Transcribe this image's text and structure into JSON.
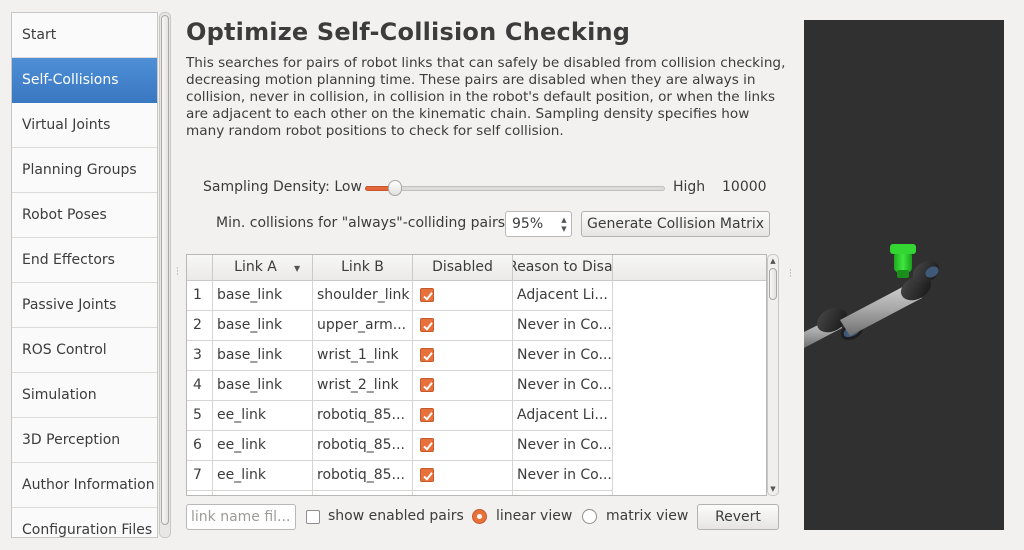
{
  "nav": {
    "items": [
      {
        "label": "Start",
        "active": false
      },
      {
        "label": "Self-Collisions",
        "active": true
      },
      {
        "label": "Virtual Joints",
        "active": false
      },
      {
        "label": "Planning Groups",
        "active": false
      },
      {
        "label": "Robot Poses",
        "active": false
      },
      {
        "label": "End Effectors",
        "active": false
      },
      {
        "label": "Passive Joints",
        "active": false
      },
      {
        "label": "ROS Control",
        "active": false
      },
      {
        "label": "Simulation",
        "active": false
      },
      {
        "label": "3D Perception",
        "active": false
      },
      {
        "label": "Author Information",
        "active": false
      },
      {
        "label": "Configuration Files",
        "active": false
      }
    ]
  },
  "page": {
    "title": "Optimize Self-Collision Checking",
    "description": "This searches for pairs of robot links that can safely be disabled from collision checking, decreasing motion planning time. These pairs are disabled when they are always in collision, never in collision, in collision in the robot's default position, or when the links are adjacent to each other on the kinematic chain. Sampling density specifies how many random robot positions to check for self collision."
  },
  "density": {
    "label": "Sampling Density: Low",
    "high_label": "High",
    "value": "10000",
    "slider_fraction": 0.1
  },
  "min_collisions": {
    "label": "Min. collisions for \"always\"-colliding pairs:",
    "value": "95%"
  },
  "generate_button": "Generate Collision Matrix",
  "table": {
    "headers": {
      "link_a": "Link A",
      "link_b": "Link B",
      "disabled": "Disabled",
      "reason": "Reason to Disable"
    },
    "rows": [
      {
        "index": "1",
        "link_a": "base_link",
        "link_b": "shoulder_link",
        "disabled": true,
        "reason": "Adjacent Li..."
      },
      {
        "index": "2",
        "link_a": "base_link",
        "link_b": "upper_arm...",
        "disabled": true,
        "reason": "Never in Co..."
      },
      {
        "index": "3",
        "link_a": "base_link",
        "link_b": "wrist_1_link",
        "disabled": true,
        "reason": "Never in Co..."
      },
      {
        "index": "4",
        "link_a": "base_link",
        "link_b": "wrist_2_link",
        "disabled": true,
        "reason": "Never in Co..."
      },
      {
        "index": "5",
        "link_a": "ee_link",
        "link_b": "robotiq_85...",
        "disabled": true,
        "reason": "Adjacent Li..."
      },
      {
        "index": "6",
        "link_a": "ee_link",
        "link_b": "robotiq_85...",
        "disabled": true,
        "reason": "Never in Co..."
      },
      {
        "index": "7",
        "link_a": "ee_link",
        "link_b": "robotiq_85...",
        "disabled": true,
        "reason": "Never in Co..."
      }
    ]
  },
  "bottom": {
    "filter_placeholder": "link name fil...",
    "show_enabled_label": "show enabled pairs",
    "show_enabled_checked": false,
    "linear_view_label": "linear view",
    "linear_view_selected": true,
    "matrix_view_label": "matrix view",
    "matrix_view_selected": false,
    "revert_label": "Revert"
  },
  "colors": {
    "accent": "#e8703a",
    "nav_active": "#3a78c2",
    "viewport_bg": "#303030",
    "robot_gripper": "#22cc22"
  }
}
